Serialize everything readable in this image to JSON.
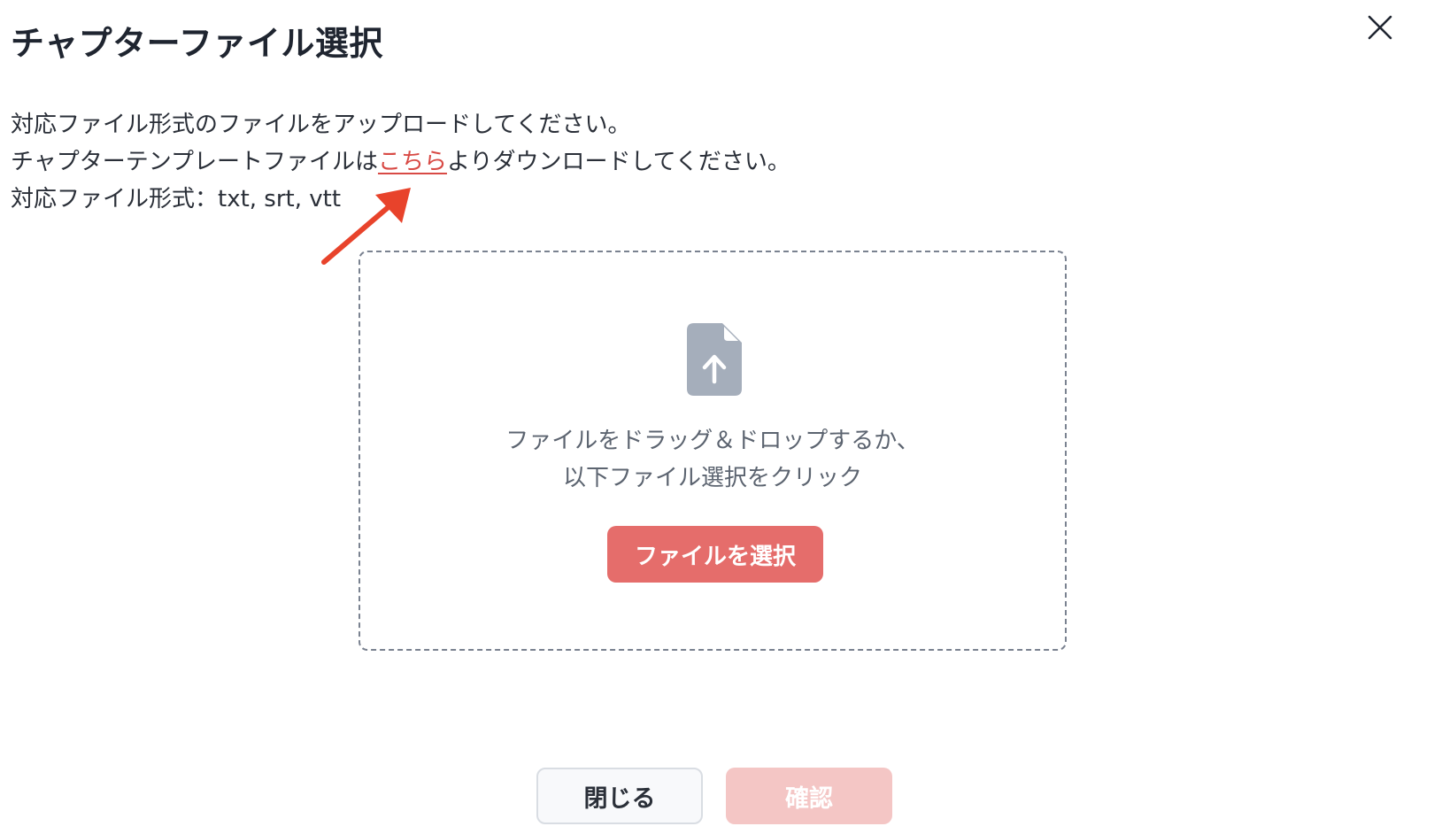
{
  "dialog": {
    "title": "チャプターファイル選択",
    "close_icon": "close-icon"
  },
  "instructions": {
    "line1": "対応ファイル形式のファイルをアップロードしてください。",
    "line2_before": "チャプターテンプレートファイルは",
    "line2_link": "こちら",
    "line2_after": "よりダウンロードしてください。",
    "line3": "対応ファイル形式：txt, srt, vtt"
  },
  "dropzone": {
    "icon": "file-upload-icon",
    "text_line1": "ファイルをドラッグ＆ドロップするか、",
    "text_line2": "以下ファイル選択をクリック",
    "select_label": "ファイルを選択"
  },
  "footer": {
    "close_label": "閉じる",
    "confirm_label": "確認"
  },
  "colors": {
    "accent": "#e56d6b",
    "accent_disabled": "#f4c6c5",
    "link": "#d84a45",
    "annotation": "#e8432b"
  }
}
